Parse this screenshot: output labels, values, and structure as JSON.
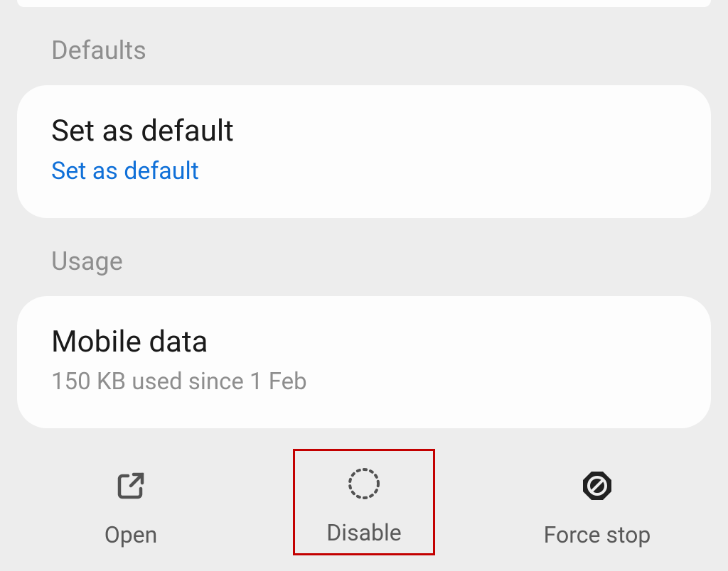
{
  "sections": {
    "defaults": {
      "header": "Defaults",
      "item": {
        "title": "Set as default",
        "link": "Set as default"
      }
    },
    "usage": {
      "header": "Usage",
      "item": {
        "title": "Mobile data",
        "subtitle": "150 KB used since 1 Feb"
      }
    }
  },
  "actions": {
    "open": "Open",
    "disable": "Disable",
    "force_stop": "Force stop"
  }
}
